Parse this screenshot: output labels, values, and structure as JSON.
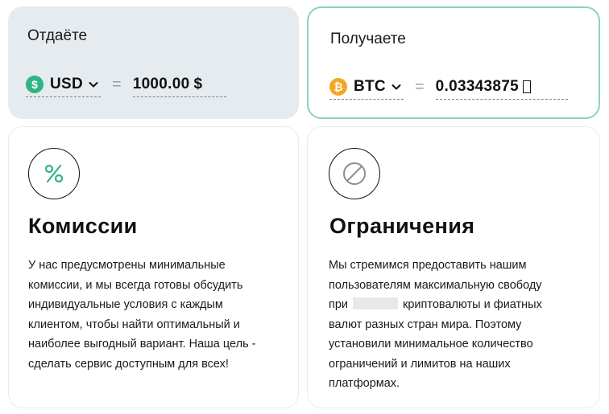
{
  "give": {
    "title": "Отдаёте",
    "currency_symbol": "$",
    "currency_icon": "dollar-coin-icon",
    "currency_code": "USD",
    "amount": "1000.00",
    "amount_symbol": "$",
    "equals": "="
  },
  "get": {
    "title": "Получаете",
    "currency_symbol": "₿",
    "currency_icon": "bitcoin-coin-icon",
    "currency_code": "BTC",
    "amount": "0.03343875",
    "equals": "="
  },
  "features": [
    {
      "icon": "percent-icon",
      "title": "Комиссии",
      "lines": [
        "У нас предусмотрены минимальные",
        "комиссии, и мы всегда готовы обсудить",
        "индивидуальные условия с каждым",
        "клиентом, чтобы найти оптимальный и",
        "наиболее выгодный вариант. Наша цель -",
        "сделать сервис доступным для всех!"
      ]
    },
    {
      "icon": "prohibited-icon",
      "title": "Ограничения",
      "lines": [
        "Мы стремимся предоставить нашим",
        "пользователям максимальную свободу",
        "при",
        "криптовалюты и фиатных",
        "валют разных стран мира. Поэтому",
        "установили минимальное количество",
        "ограничений и лимитов на наших",
        "платформах."
      ]
    }
  ],
  "colors": {
    "usd_coin": "#2fb584",
    "btc_coin": "#f5a623",
    "active_border": "#8dd3b4",
    "give_background": "#e6ebef",
    "accent": "#2fb584"
  }
}
